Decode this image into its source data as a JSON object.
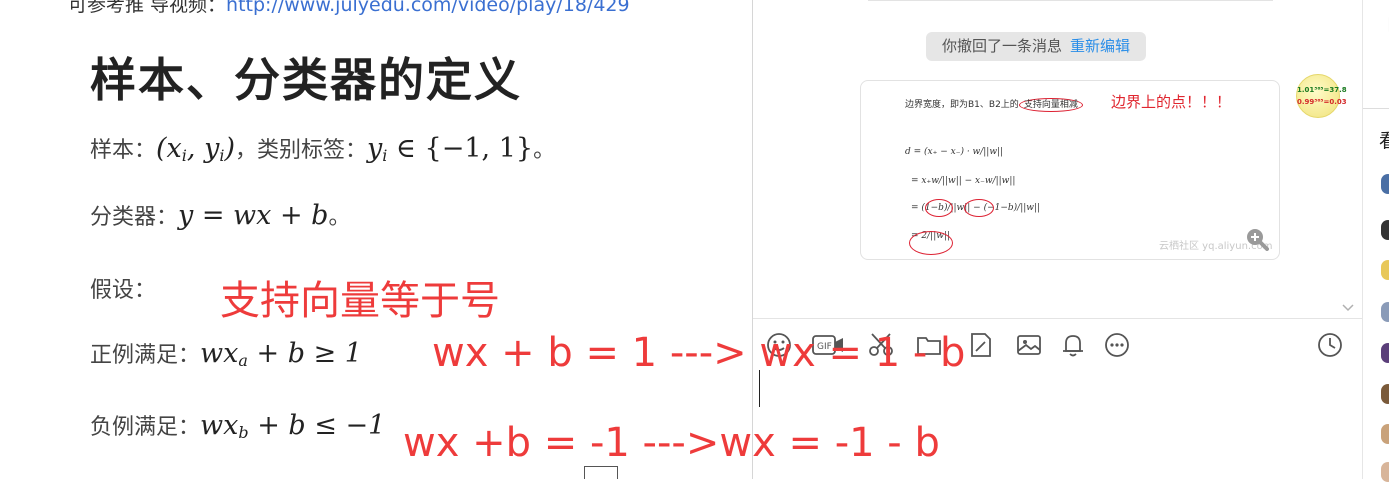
{
  "doc": {
    "ref_prefix": "可参考推 导视频：",
    "ref_link": "http://www.julyedu.com/video/play/18/429",
    "title": "样本、分类器的定义",
    "sample_label": "样本：",
    "sample_math": "(x",
    "sample_sub_i": "i",
    "sample_math_mid": ", y",
    "sample_sub_i2": "i",
    "sample_math_end": ")",
    "class_label": "，类别标签：",
    "class_math": "y",
    "class_sub": "i",
    "class_math_end": " ∈ {−1, 1}",
    "class_period": "。",
    "classifier_label": "分类器：",
    "classifier_math": "y = wx + b",
    "classifier_period": "。",
    "assume_label": "假设：",
    "pos_label": "正例满足：",
    "pos_math": "wx",
    "pos_sub": "a",
    "pos_math_end": " + b ≥ 1",
    "neg_label": "负例满足：",
    "neg_math": "wx",
    "neg_sub": "b",
    "neg_math_end": " + b ≤ −1",
    "annotation_support": "支持向量等于号",
    "annotation_pos": "wx + b = 1 ---> wx = 1 - b",
    "annotation_neg": "wx +b = -1 --->wx = -1 - b"
  },
  "chat": {
    "recall_text": "你撤回了一条消息",
    "reedit_label": "重新编辑",
    "bubble": {
      "line1_prefix": "边界宽度，即为B1、B2上的",
      "line1_circled": "支持向量相减",
      "line1_red": "边界上的点！！！",
      "formula1": "d = (x₊ − x₋) · w/||w||",
      "formula2": "= x₊w/||w|| − x₋w/||w||",
      "formula3": "= (1−b)/||w|| − (−1−b)/||w||",
      "formula4": "= 2/||w||",
      "watermark": "云栖社区 yq.aliyun.com"
    },
    "avatar": {
      "line1": "1.01³⁶⁵=37.8",
      "line2": "0.99³⁶⁵=0.03"
    },
    "toolbar_icons": [
      "emoji-icon",
      "gif-icon",
      "video-call-icon",
      "scissors-icon",
      "folder-icon",
      "document-edit-icon",
      "image-icon",
      "bell-icon",
      "more-icon",
      "history-icon"
    ]
  },
  "strip": {
    "bracket": "【",
    "char": "看"
  },
  "colors": {
    "annotation_red": "#ee3b3b",
    "link_blue": "#3a6fd1",
    "reedit_blue": "#2a8ee8"
  }
}
